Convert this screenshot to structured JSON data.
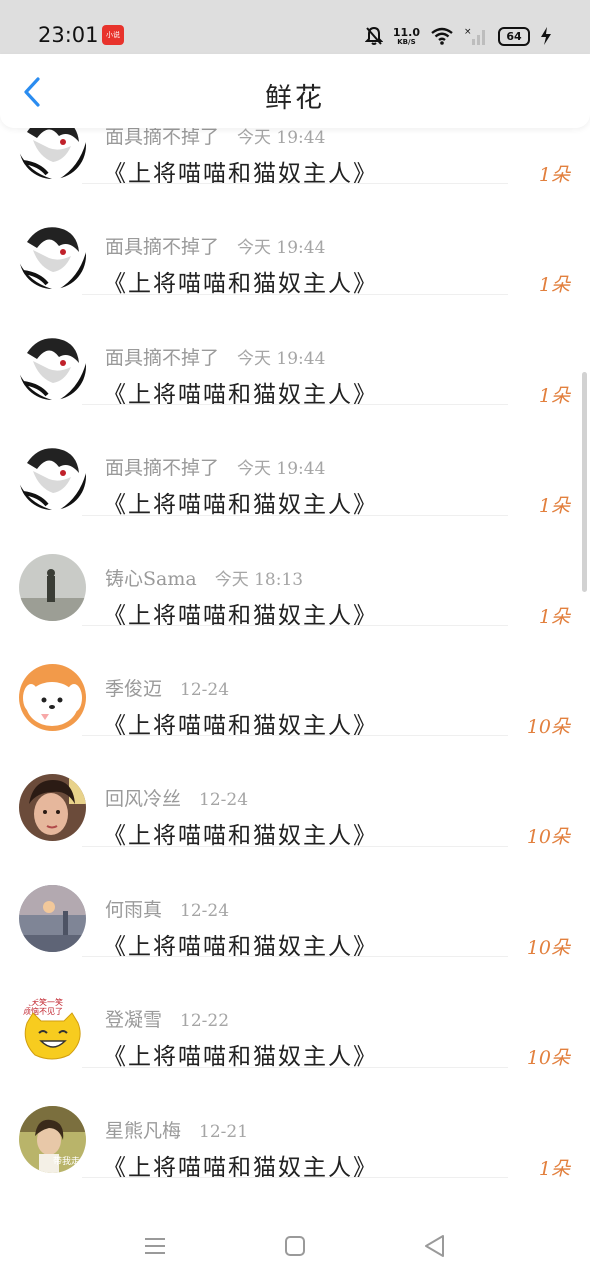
{
  "status_bar": {
    "time": "23:01",
    "app_badge": "小说",
    "net_speed_value": "11.0",
    "net_speed_unit": "KB/S",
    "battery": "64",
    "icons": [
      "mute-bell-icon",
      "wifi-icon",
      "signal-icon",
      "charging-icon"
    ]
  },
  "header": {
    "title": "鲜花",
    "back_icon": "chevron-left-icon"
  },
  "accent_color": "#2a8cf0",
  "count_color": "#e2803e",
  "items": [
    {
      "sender": "面具摘不掉了",
      "time": "今天 19:44",
      "gift": "《上将喵喵和猫奴主人》",
      "count": "1朵",
      "avatar": "bw-anime"
    },
    {
      "sender": "面具摘不掉了",
      "time": "今天 19:44",
      "gift": "《上将喵喵和猫奴主人》",
      "count": "1朵",
      "avatar": "bw-anime"
    },
    {
      "sender": "面具摘不掉了",
      "time": "今天 19:44",
      "gift": "《上将喵喵和猫奴主人》",
      "count": "1朵",
      "avatar": "bw-anime"
    },
    {
      "sender": "面具摘不掉了",
      "time": "今天 19:44",
      "gift": "《上将喵喵和猫奴主人》",
      "count": "1朵",
      "avatar": "bw-anime"
    },
    {
      "sender": "铸心Sama",
      "time": "今天 18:13",
      "gift": "《上将喵喵和猫奴主人》",
      "count": "1朵",
      "avatar": "foggy-person"
    },
    {
      "sender": "季俊迈",
      "time": "12-24",
      "gift": "《上将喵喵和猫奴主人》",
      "count": "10朵",
      "avatar": "cartoon-dog"
    },
    {
      "sender": "回风冷丝",
      "time": "12-24",
      "gift": "《上将喵喵和猫奴主人》",
      "count": "10朵",
      "avatar": "woman-photo"
    },
    {
      "sender": "何雨真",
      "time": "12-24",
      "gift": "《上将喵喵和猫奴主人》",
      "count": "10朵",
      "avatar": "misty-sunset"
    },
    {
      "sender": "登凝雪",
      "time": "12-22",
      "gift": "《上将喵喵和猫奴主人》",
      "count": "10朵",
      "avatar": "yellow-cat"
    },
    {
      "sender": "星熊凡梅",
      "time": "12-21",
      "gift": "《上将喵喵和猫奴主人》",
      "count": "1朵",
      "avatar": "girl-field"
    }
  ],
  "nav": {
    "menu_icon": "menu-icon",
    "home_icon": "home-square-icon",
    "back_icon": "back-triangle-icon"
  }
}
